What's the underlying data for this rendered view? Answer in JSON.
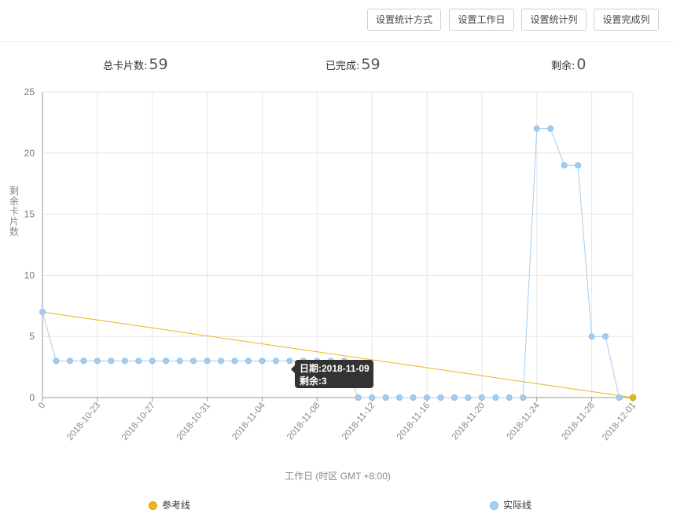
{
  "toolbar": {
    "buttons": [
      "设置统计方式",
      "设置工作日",
      "设置统计列",
      "设置完成列"
    ]
  },
  "stats": {
    "total_label": "总卡片数:",
    "total_value": "59",
    "done_label": "已完成:",
    "done_value": "59",
    "remaining_label": "剩余:",
    "remaining_value": "0"
  },
  "colors": {
    "reference": "#e6b71e",
    "actual": "#a6cdee",
    "actual_border": "#8bbde6",
    "grid": "#e6e6e6",
    "tooltip_bg": "#333333"
  },
  "chart_data": {
    "type": "line",
    "xlabel": "工作日 (时区 GMT +8:00)",
    "ylabel": "剩余卡片数",
    "ylim": [
      0,
      25
    ],
    "yticks": [
      0,
      5,
      10,
      15,
      20,
      25
    ],
    "xticks": [
      "0",
      "2018-10-23",
      "2018-10-27",
      "2018-10-31",
      "2018-11-04",
      "2018-11-08",
      "2018-11-12",
      "2018-11-16",
      "2018-11-20",
      "2018-11-24",
      "2018-11-28",
      "2018-12-01"
    ],
    "grid": true,
    "legend_position": "bottom",
    "series": [
      {
        "name": "参考线",
        "x": [
          "2018-10-19",
          "2018-12-01"
        ],
        "values": [
          7,
          0
        ]
      },
      {
        "name": "实际线",
        "x": [
          "2018-10-19",
          "2018-10-20",
          "2018-10-21",
          "2018-10-22",
          "2018-10-23",
          "2018-10-24",
          "2018-10-25",
          "2018-10-26",
          "2018-10-27",
          "2018-10-28",
          "2018-10-29",
          "2018-10-30",
          "2018-10-31",
          "2018-11-01",
          "2018-11-02",
          "2018-11-03",
          "2018-11-04",
          "2018-11-05",
          "2018-11-06",
          "2018-11-07",
          "2018-11-08",
          "2018-11-09",
          "2018-11-10",
          "2018-11-11",
          "2018-11-12",
          "2018-11-13",
          "2018-11-14",
          "2018-11-15",
          "2018-11-16",
          "2018-11-17",
          "2018-11-18",
          "2018-11-19",
          "2018-11-20",
          "2018-11-21",
          "2018-11-22",
          "2018-11-23",
          "2018-11-24",
          "2018-11-25",
          "2018-11-26",
          "2018-11-27",
          "2018-11-28",
          "2018-11-29",
          "2018-11-30"
        ],
        "values": [
          7,
          3,
          3,
          3,
          3,
          3,
          3,
          3,
          3,
          3,
          3,
          3,
          3,
          3,
          3,
          3,
          3,
          3,
          3,
          3,
          3,
          3,
          3,
          0,
          0,
          0,
          0,
          0,
          0,
          0,
          0,
          0,
          0,
          0,
          0,
          0,
          22,
          22,
          19,
          19,
          5,
          5,
          0
        ]
      }
    ],
    "tooltip": {
      "date_label": "日期:2018-11-09",
      "value_label": "剩余:3"
    }
  }
}
